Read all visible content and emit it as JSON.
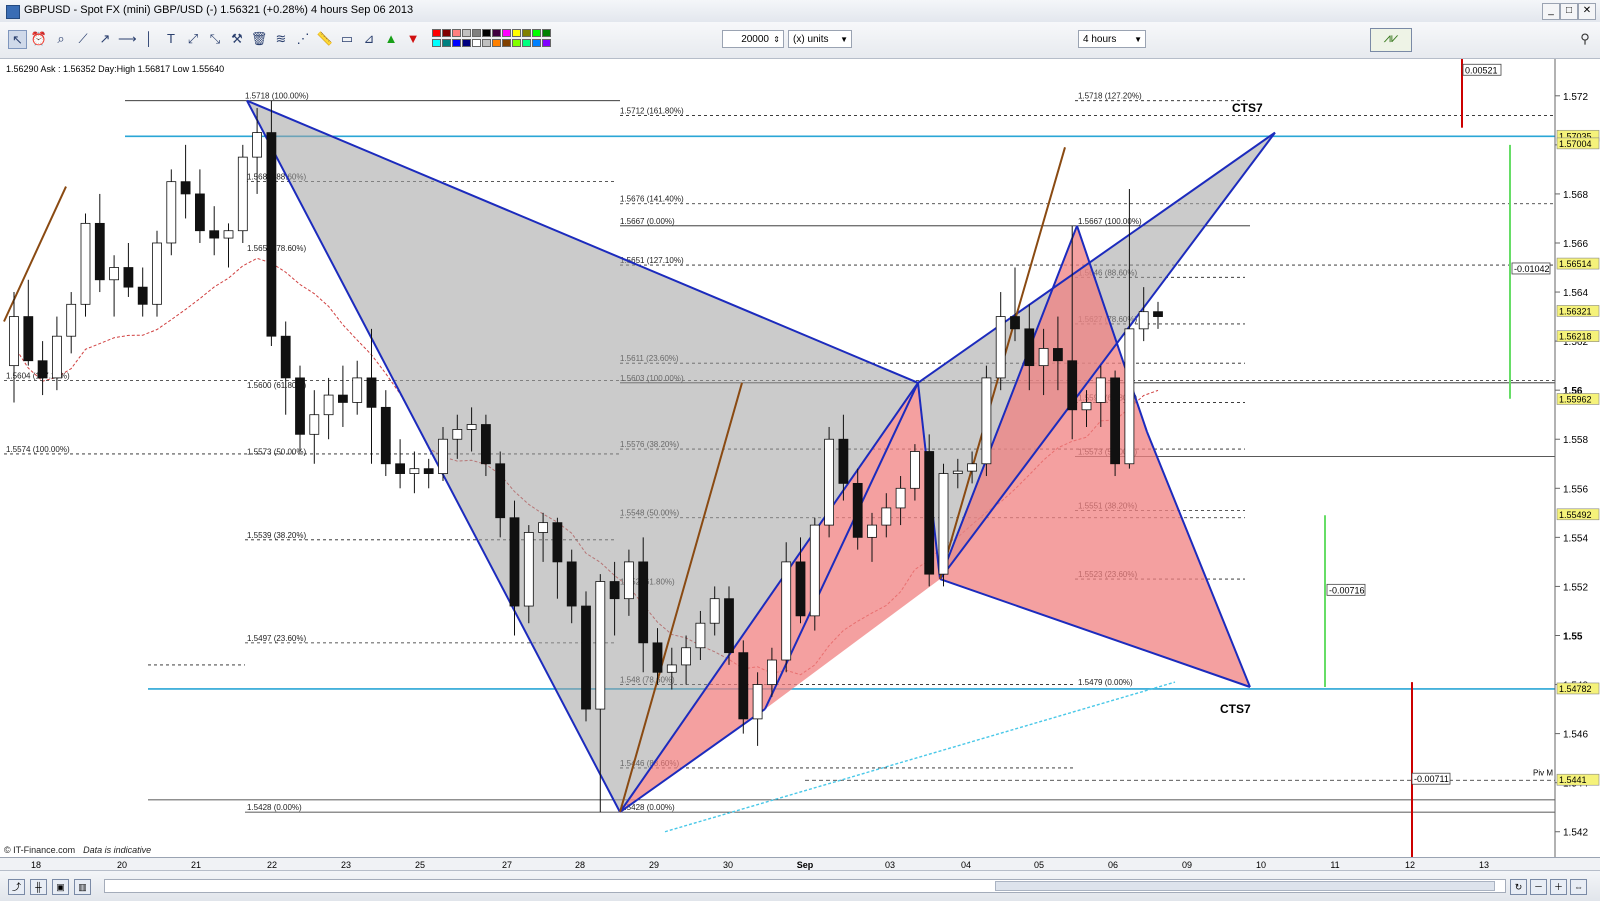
{
  "window": {
    "title": "GBPUSD - Spot FX (mini) GBP/USD (-)    1.56321 (+0.28%)    4 hours   Sep 06 2013"
  },
  "toolbar": {
    "quantity": "20000",
    "units": "(x) units",
    "timeframe": "4 hours",
    "colors": [
      "#ff0000",
      "#800000",
      "#ff8080",
      "#c0c0c0",
      "#808080",
      "#000000",
      "#400040",
      "#ff00ff",
      "#ffff00",
      "#808000",
      "#00ff00",
      "#008000",
      "#00ffff",
      "#008080",
      "#0000ff",
      "#000080",
      "#ffffff",
      "#c0c0c0",
      "#ff8000",
      "#804000",
      "#80ff00",
      "#00ff80",
      "#0080ff",
      "#8000ff"
    ]
  },
  "info_line": "1.56290 Ask : 1.56352 Day:High 1.56817 Low 1.55640",
  "footer": {
    "brand": "© IT-Finance.com",
    "note": "Data is indicative"
  },
  "chart_data": {
    "type": "candlestick",
    "symbol": "GBPUSD",
    "timeframe": "4 hours",
    "y_range": [
      1.5415,
      1.5735
    ],
    "y_ticks": [
      {
        "v": 1.572,
        "t": "1.572",
        "bold": false
      },
      {
        "v": 1.57,
        "t": "1.57",
        "bold": true
      },
      {
        "v": 1.568,
        "t": "1.568",
        "bold": false
      },
      {
        "v": 1.566,
        "t": "1.566",
        "bold": false
      },
      {
        "v": 1.564,
        "t": "1.564",
        "bold": false
      },
      {
        "v": 1.562,
        "t": "1.562",
        "bold": false
      },
      {
        "v": 1.56,
        "t": "1.56",
        "bold": true
      },
      {
        "v": 1.558,
        "t": "1.558",
        "bold": false
      },
      {
        "v": 1.556,
        "t": "1.556",
        "bold": false
      },
      {
        "v": 1.554,
        "t": "1.554",
        "bold": false
      },
      {
        "v": 1.552,
        "t": "1.552",
        "bold": false
      },
      {
        "v": 1.55,
        "t": "1.55",
        "bold": true
      },
      {
        "v": 1.548,
        "t": "1.548",
        "bold": false
      },
      {
        "v": 1.546,
        "t": "1.546",
        "bold": false
      },
      {
        "v": 1.544,
        "t": "1.544",
        "bold": false
      },
      {
        "v": 1.542,
        "t": "1.542",
        "bold": false
      }
    ],
    "x_labels": [
      "18",
      "20",
      "21",
      "22",
      "23",
      "25",
      "27",
      "28",
      "29",
      "30",
      "Sep",
      "03",
      "04",
      "05",
      "06",
      "09",
      "10",
      "11",
      "12",
      "13"
    ],
    "x_label_bold": "Sep",
    "price_tags": [
      {
        "v": 1.57035,
        "t": "1.57035"
      },
      {
        "v": 1.57004,
        "t": "1.57004"
      },
      {
        "v": 1.56514,
        "t": "1.56514"
      },
      {
        "v": 1.56321,
        "t": "1.56321"
      },
      {
        "v": 1.56218,
        "t": "1.56218"
      },
      {
        "v": 1.55962,
        "t": "1.55962"
      },
      {
        "v": 1.55492,
        "t": "1.55492"
      },
      {
        "v": 1.54782,
        "t": "1.54782"
      },
      {
        "v": 1.5441,
        "t": "1.5441"
      }
    ],
    "measure_labels": [
      "0.00521",
      "-0.01042",
      "-0.00716",
      "-0.00711"
    ],
    "pattern_labels": [
      "CTS7",
      "CTS7"
    ],
    "pivot_label": "Piv M",
    "fib_labels": [
      "1.5718 (100.00%)",
      "1.5712 (161.80%)",
      "1.5718 (127.20%)",
      "1.5685 (88.60%)",
      "1.5676 (141.40%)",
      "1.5667 (0.00%)",
      "1.5667 (100.00%)",
      "1.5656 (78.60%)",
      "1.5651 (127.10%)",
      "1.5646 (88.60%)",
      "1.5627 (78.60%)",
      "1.5611 (23.60%)",
      "1.5604 (127.10%)",
      "1.5603 (100.00%)",
      "1.5600 (61.80%)",
      "1.5595 (61.80%)",
      "1.5576 (38.20%)",
      "1.5574 (100.00%)",
      "1.5573 (50.00%)",
      "1.5573 (50.00%)",
      "1.5551 (38.20%)",
      "1.5548 (50.00%)",
      "1.5539 (38.20%)",
      "1.5523 (23.60%)",
      "1.552 (61.80%)",
      "1.5497 (23.60%)",
      "1.548 (78.60%)",
      "1.5479 (0.00%)",
      "1.5446 (88.60%)",
      "1.5428 (0.00%)",
      "1.5428 (0.00%)"
    ],
    "harmonic_patterns": [
      {
        "name": "left bat",
        "X": [
          22.0,
          1.5718
        ],
        "A": [
          28.5,
          1.5428
        ],
        "B": [
          33.5,
          1.5603
        ],
        "C": [
          30.5,
          1.5475
        ],
        "D": [
          37.5,
          1.5523
        ]
      },
      {
        "name": "right bat",
        "X": [
          33.6,
          1.5523
        ],
        "A": [
          38.2,
          1.5667
        ],
        "B": [
          39.0,
          1.5573
        ],
        "C": [
          44.0,
          1.57
        ],
        "D": [
          43.8,
          1.5479
        ]
      }
    ],
    "ohlc": [
      [
        1.561,
        1.564,
        1.5595,
        1.563
      ],
      [
        1.563,
        1.5645,
        1.561,
        1.5612
      ],
      [
        1.5612,
        1.562,
        1.5598,
        1.5605
      ],
      [
        1.5605,
        1.563,
        1.56,
        1.5622
      ],
      [
        1.5622,
        1.564,
        1.5615,
        1.5635
      ],
      [
        1.5635,
        1.5672,
        1.563,
        1.5668
      ],
      [
        1.5668,
        1.568,
        1.564,
        1.5645
      ],
      [
        1.5645,
        1.5655,
        1.563,
        1.565
      ],
      [
        1.565,
        1.566,
        1.5638,
        1.5642
      ],
      [
        1.5642,
        1.565,
        1.563,
        1.5635
      ],
      [
        1.5635,
        1.5665,
        1.563,
        1.566
      ],
      [
        1.566,
        1.569,
        1.5655,
        1.5685
      ],
      [
        1.5685,
        1.57,
        1.567,
        1.568
      ],
      [
        1.568,
        1.569,
        1.566,
        1.5665
      ],
      [
        1.5665,
        1.5675,
        1.5655,
        1.5662
      ],
      [
        1.5662,
        1.5668,
        1.565,
        1.5665
      ],
      [
        1.5665,
        1.57,
        1.566,
        1.5695
      ],
      [
        1.5695,
        1.5715,
        1.568,
        1.5705
      ],
      [
        1.5705,
        1.5718,
        1.5618,
        1.5622
      ],
      [
        1.5622,
        1.5628,
        1.559,
        1.5605
      ],
      [
        1.5605,
        1.561,
        1.5575,
        1.5582
      ],
      [
        1.5582,
        1.56,
        1.557,
        1.559
      ],
      [
        1.559,
        1.5605,
        1.558,
        1.5598
      ],
      [
        1.5598,
        1.561,
        1.5585,
        1.5595
      ],
      [
        1.5595,
        1.5612,
        1.559,
        1.5605
      ],
      [
        1.5605,
        1.5625,
        1.557,
        1.5593
      ],
      [
        1.5593,
        1.56,
        1.5565,
        1.557
      ],
      [
        1.557,
        1.558,
        1.556,
        1.5566
      ],
      [
        1.5566,
        1.5575,
        1.5558,
        1.5568
      ],
      [
        1.5568,
        1.5572,
        1.556,
        1.5566
      ],
      [
        1.5566,
        1.5585,
        1.5563,
        1.558
      ],
      [
        1.558,
        1.559,
        1.5572,
        1.5584
      ],
      [
        1.5584,
        1.5593,
        1.5575,
        1.5586
      ],
      [
        1.5586,
        1.559,
        1.5565,
        1.557
      ],
      [
        1.557,
        1.5575,
        1.554,
        1.5548
      ],
      [
        1.5548,
        1.5555,
        1.55,
        1.5512
      ],
      [
        1.5512,
        1.5545,
        1.5505,
        1.5542
      ],
      [
        1.5542,
        1.555,
        1.553,
        1.5546
      ],
      [
        1.5546,
        1.5548,
        1.5515,
        1.553
      ],
      [
        1.553,
        1.5535,
        1.5505,
        1.5512
      ],
      [
        1.5512,
        1.5518,
        1.5465,
        1.547
      ],
      [
        1.547,
        1.5525,
        1.5428,
        1.5522
      ],
      [
        1.5522,
        1.553,
        1.55,
        1.5515
      ],
      [
        1.5515,
        1.5535,
        1.5508,
        1.553
      ],
      [
        1.553,
        1.554,
        1.5485,
        1.5497
      ],
      [
        1.5497,
        1.5503,
        1.548,
        1.5485
      ],
      [
        1.5485,
        1.5495,
        1.5478,
        1.5488
      ],
      [
        1.5488,
        1.55,
        1.548,
        1.5495
      ],
      [
        1.5495,
        1.551,
        1.549,
        1.5505
      ],
      [
        1.5505,
        1.552,
        1.55,
        1.5515
      ],
      [
        1.5515,
        1.552,
        1.5488,
        1.5493
      ],
      [
        1.5493,
        1.5498,
        1.546,
        1.5466
      ],
      [
        1.5466,
        1.5485,
        1.5455,
        1.548
      ],
      [
        1.548,
        1.5495,
        1.5475,
        1.549
      ],
      [
        1.549,
        1.5538,
        1.5485,
        1.553
      ],
      [
        1.553,
        1.554,
        1.5505,
        1.5508
      ],
      [
        1.5508,
        1.5548,
        1.5502,
        1.5545
      ],
      [
        1.5545,
        1.5585,
        1.554,
        1.558
      ],
      [
        1.558,
        1.559,
        1.5555,
        1.5562
      ],
      [
        1.5562,
        1.5568,
        1.5535,
        1.554
      ],
      [
        1.554,
        1.555,
        1.553,
        1.5545
      ],
      [
        1.5545,
        1.5558,
        1.554,
        1.5552
      ],
      [
        1.5552,
        1.5565,
        1.5545,
        1.556
      ],
      [
        1.556,
        1.5578,
        1.5555,
        1.5575
      ],
      [
        1.5575,
        1.5582,
        1.552,
        1.5525
      ],
      [
        1.5525,
        1.557,
        1.552,
        1.5566
      ],
      [
        1.5566,
        1.5572,
        1.556,
        1.5567
      ],
      [
        1.5567,
        1.5575,
        1.5562,
        1.557
      ],
      [
        1.557,
        1.561,
        1.5565,
        1.5605
      ],
      [
        1.5605,
        1.564,
        1.56,
        1.563
      ],
      [
        1.563,
        1.565,
        1.562,
        1.5625
      ],
      [
        1.5625,
        1.5635,
        1.56,
        1.561
      ],
      [
        1.561,
        1.5625,
        1.5598,
        1.5617
      ],
      [
        1.5617,
        1.563,
        1.56,
        1.5612
      ],
      [
        1.5612,
        1.5667,
        1.558,
        1.5592
      ],
      [
        1.5592,
        1.56,
        1.5585,
        1.5595
      ],
      [
        1.5595,
        1.561,
        1.5585,
        1.5605
      ],
      [
        1.5605,
        1.5608,
        1.5565,
        1.557
      ],
      [
        1.557,
        1.5682,
        1.5568,
        1.5625
      ],
      [
        1.5625,
        1.5642,
        1.562,
        1.5632
      ],
      [
        1.5632,
        1.5636,
        1.5625,
        1.563
      ]
    ]
  }
}
